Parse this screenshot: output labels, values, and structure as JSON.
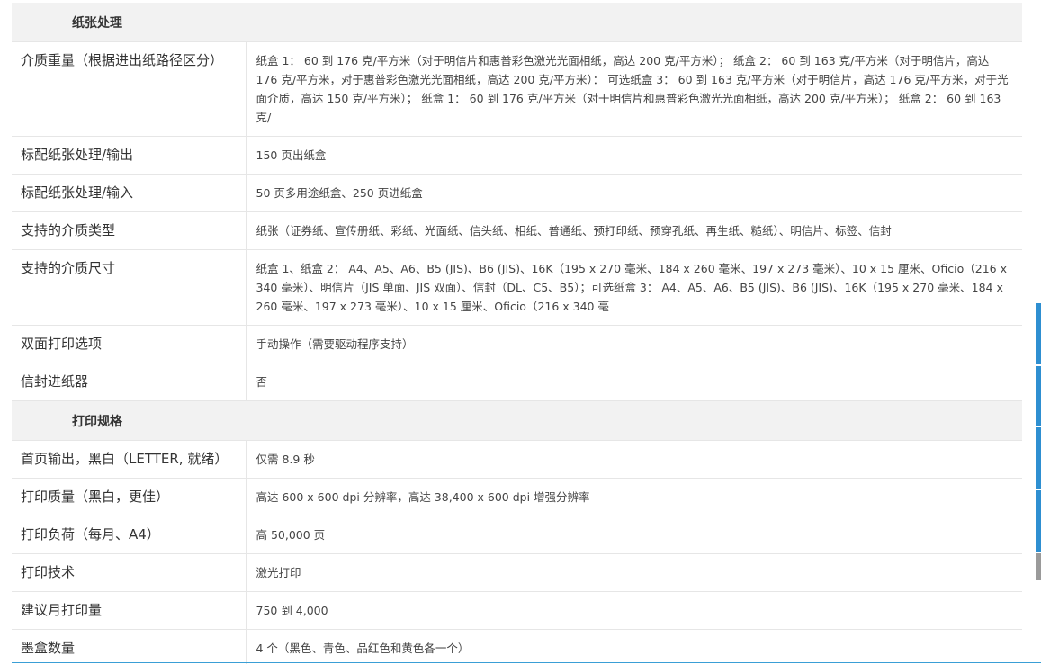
{
  "sections": [
    {
      "title": "纸张处理",
      "rows": [
        {
          "label": "介质重量（根据进出纸路径区分）",
          "value": "纸盒 1： 60 到 176 克/平方米（对于明信片和惠普彩色激光光面相纸，高达 200 克/平方米）； 纸盒 2： 60 到 163 克/平方米（对于明信片，高达 176 克/平方米，对于惠普彩色激光光面相纸，高达 200 克/平方米）： 可选纸盒 3： 60 到 163 克/平方米（对于明信片，高达 176 克/平方米，对于光面介质，高达 150 克/平方米）； 纸盒 1： 60 到 176 克/平方米（对于明信片和惠普彩色激光光面相纸，高达 200 克/平方米）； 纸盒 2： 60 到 163 克/"
        },
        {
          "label": "标配纸张处理/输出",
          "value": "150 页出纸盒"
        },
        {
          "label": "标配纸张处理/输入",
          "value": "50 页多用途纸盒、250 页进纸盒"
        },
        {
          "label": "支持的介质类型",
          "value": "纸张（证券纸、宣传册纸、彩纸、光面纸、信头纸、相纸、普通纸、预打印纸、预穿孔纸、再生纸、糙纸）、明信片、标签、信封"
        },
        {
          "label": "支持的介质尺寸",
          "value": "纸盒 1、纸盒 2： A4、A5、A6、B5 (JIS)、B6 (JIS)、16K（195 x 270 毫米、184 x 260 毫米、197 x 273 毫米）、10 x 15 厘米、Oficio（216 x 340 毫米）、明信片（JIS 单面、JIS 双面）、信封（DL、C5、B5）；可选纸盒 3： A4、A5、A6、B5 (JIS)、B6 (JIS)、16K（195 x 270 毫米、184 x 260 毫米、197 x 273 毫米）、10 x 15 厘米、Oficio（216 x 340 毫"
        },
        {
          "label": "双面打印选项",
          "value": "手动操作（需要驱动程序支持）"
        },
        {
          "label": "信封进纸器",
          "value": "否"
        }
      ]
    },
    {
      "title": "打印规格",
      "rows": [
        {
          "label": "首页输出，黑白（LETTER, 就绪）",
          "value": "仅需 8.9 秒"
        },
        {
          "label": "打印质量（黑白，更佳）",
          "value": "高达 600 x 600 dpi 分辨率，高达 38,400 x 600 dpi 增强分辨率"
        },
        {
          "label": "打印负荷（每月、A4）",
          "value": "高 50,000 页"
        },
        {
          "label": "打印技术",
          "value": "激光打印"
        },
        {
          "label": "建议月打印量",
          "value": "750 到 4,000"
        },
        {
          "label": "墨盒数量",
          "value": "4 个（黑色、青色、品红色和黄色各一个）"
        }
      ]
    }
  ],
  "colors": {
    "section_bg": "#f2f2f2",
    "border": "#e6e6e6",
    "side_toolbar": "#2e8fd1"
  }
}
